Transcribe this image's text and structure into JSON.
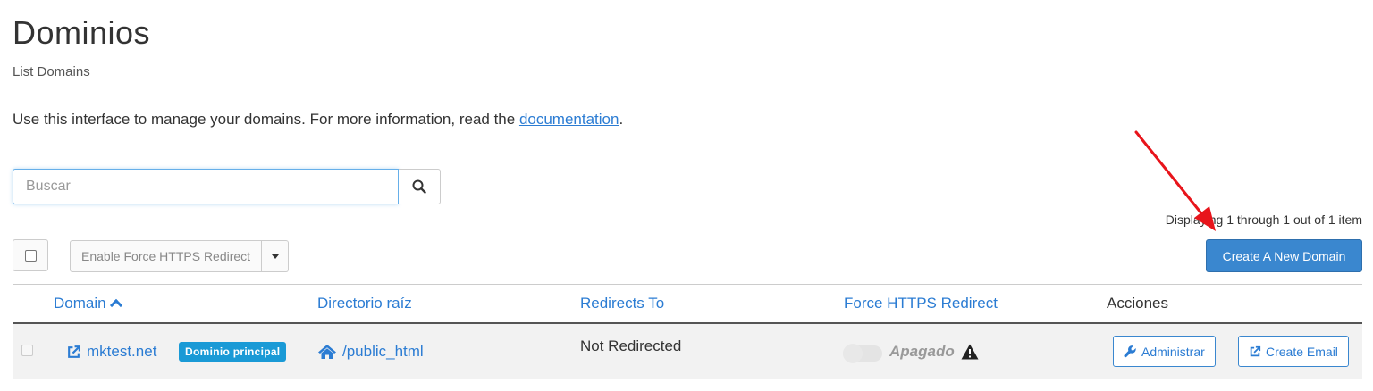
{
  "header": {
    "title": "Dominios",
    "subtitle": "List Domains"
  },
  "intro": {
    "text": "Use this interface to manage your domains. For more information, read the ",
    "link_text": "documentation",
    "suffix": "."
  },
  "search": {
    "placeholder": "Buscar",
    "value": ""
  },
  "pagination": {
    "displaying": "Displaying 1 through 1 out of 1 item"
  },
  "toolbar": {
    "bulk_action_label": "Enable Force HTTPS Redirect",
    "create_label": "Create A New Domain"
  },
  "table": {
    "columns": {
      "domain": "Domain",
      "root": "Directorio raíz",
      "redirects": "Redirects To",
      "https": "Force HTTPS Redirect",
      "actions": "Acciones"
    },
    "rows": [
      {
        "domain": "mktest.net",
        "badge": "Dominio principal",
        "root": "/public_html",
        "redirects": "Not Redirected",
        "https_state": "Apagado",
        "manage_label": "Administrar",
        "email_label": "Create Email"
      }
    ]
  },
  "colors": {
    "link": "#2b7cd3",
    "primary_button": "#3a87cf",
    "badge": "#1a9ad6",
    "annotation_arrow": "#e8141b"
  },
  "icons": {
    "search": "search-icon",
    "sort": "caret-up-icon",
    "external": "external-link-icon",
    "home": "home-icon",
    "warning": "warning-icon",
    "wrench": "wrench-icon"
  }
}
